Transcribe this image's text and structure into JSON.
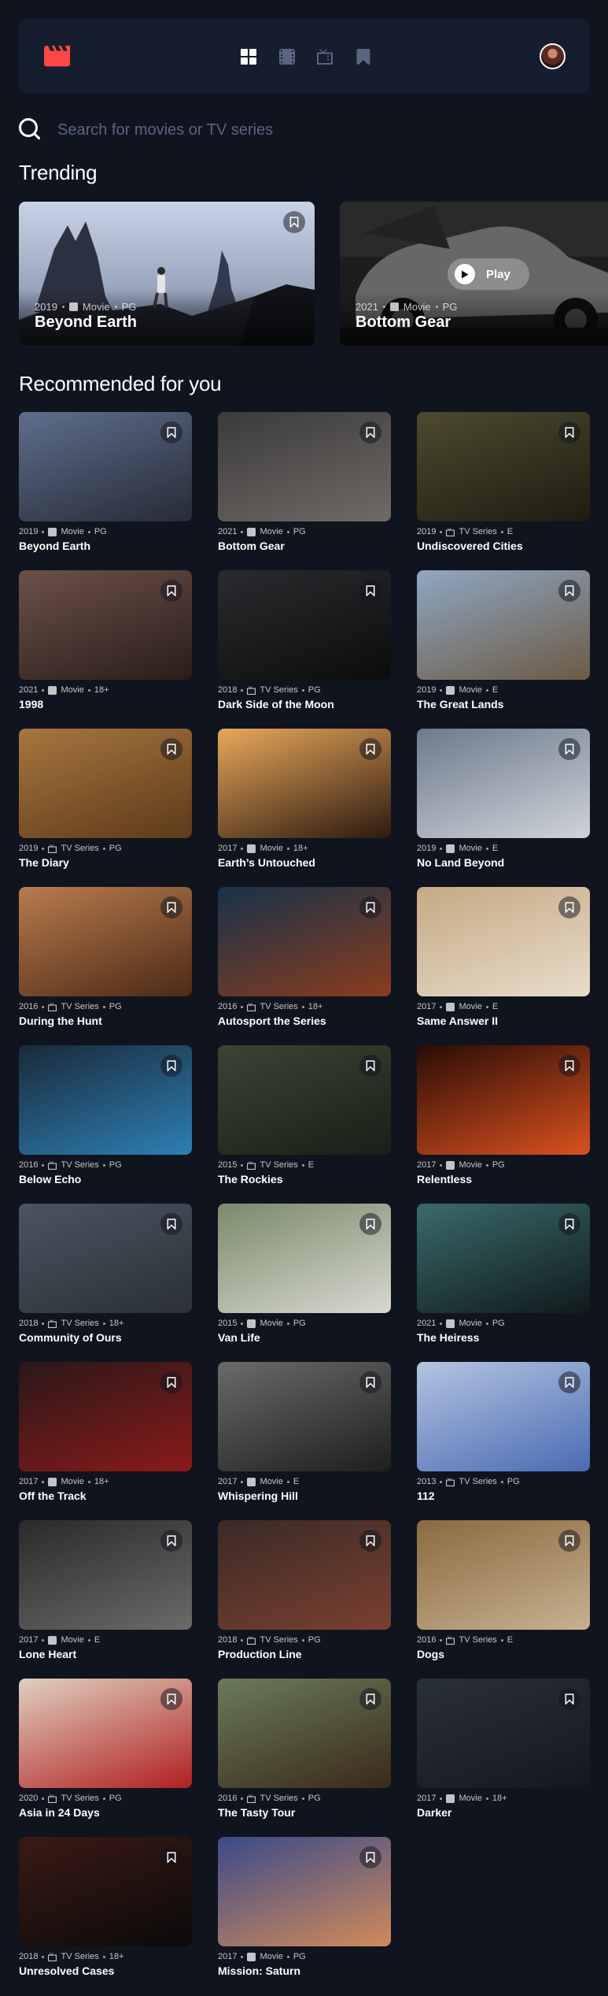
{
  "nav": {
    "logo_icon": "film-clapper-icon",
    "brand_color": "#fc4747",
    "items": [
      {
        "name": "nav-home",
        "icon": "grid-icon",
        "active": true
      },
      {
        "name": "nav-movies",
        "icon": "film-icon",
        "active": false
      },
      {
        "name": "nav-tv-series",
        "icon": "tv-icon",
        "active": false
      },
      {
        "name": "nav-bookmarks",
        "icon": "bookmark-icon",
        "active": false
      }
    ],
    "avatar": "user-avatar"
  },
  "search": {
    "placeholder": "Search for movies or TV series"
  },
  "trending": {
    "heading": "Trending",
    "items": [
      {
        "year": "2019",
        "category": "Movie",
        "rating": "PG",
        "title": "Beyond Earth",
        "bookmarked": false
      },
      {
        "year": "2021",
        "category": "Movie",
        "rating": "PG",
        "title": "Bottom Gear",
        "bookmarked": false,
        "play_label": "Play"
      }
    ]
  },
  "recommended": {
    "heading": "Recommended for you",
    "items": [
      {
        "year": "2019",
        "category": "Movie",
        "rating": "PG",
        "title": "Beyond Earth"
      },
      {
        "year": "2021",
        "category": "Movie",
        "rating": "PG",
        "title": "Bottom Gear"
      },
      {
        "year": "2019",
        "category": "TV Series",
        "rating": "E",
        "title": "Undiscovered Cities"
      },
      {
        "year": "2021",
        "category": "Movie",
        "rating": "18+",
        "title": "1998"
      },
      {
        "year": "2018",
        "category": "TV Series",
        "rating": "PG",
        "title": "Dark Side of the Moon"
      },
      {
        "year": "2019",
        "category": "Movie",
        "rating": "E",
        "title": "The Great Lands"
      },
      {
        "year": "2019",
        "category": "TV Series",
        "rating": "PG",
        "title": "The Diary"
      },
      {
        "year": "2017",
        "category": "Movie",
        "rating": "18+",
        "title": "Earth’s Untouched"
      },
      {
        "year": "2019",
        "category": "Movie",
        "rating": "E",
        "title": "No Land Beyond"
      },
      {
        "year": "2016",
        "category": "TV Series",
        "rating": "PG",
        "title": "During the Hunt"
      },
      {
        "year": "2016",
        "category": "TV Series",
        "rating": "18+",
        "title": "Autosport the Series"
      },
      {
        "year": "2017",
        "category": "Movie",
        "rating": "E",
        "title": "Same Answer II"
      },
      {
        "year": "2016",
        "category": "TV Series",
        "rating": "PG",
        "title": "Below Echo"
      },
      {
        "year": "2015",
        "category": "TV Series",
        "rating": "E",
        "title": "The Rockies"
      },
      {
        "year": "2017",
        "category": "Movie",
        "rating": "PG",
        "title": "Relentless"
      },
      {
        "year": "2018",
        "category": "TV Series",
        "rating": "18+",
        "title": "Community of Ours"
      },
      {
        "year": "2015",
        "category": "Movie",
        "rating": "PG",
        "title": "Van Life"
      },
      {
        "year": "2021",
        "category": "Movie",
        "rating": "PG",
        "title": "The Heiress"
      },
      {
        "year": "2017",
        "category": "Movie",
        "rating": "18+",
        "title": "Off the Track"
      },
      {
        "year": "2017",
        "category": "Movie",
        "rating": "E",
        "title": "Whispering Hill"
      },
      {
        "year": "2013",
        "category": "TV Series",
        "rating": "PG",
        "title": "112"
      },
      {
        "year": "2017",
        "category": "Movie",
        "rating": "E",
        "title": "Lone Heart"
      },
      {
        "year": "2018",
        "category": "TV Series",
        "rating": "PG",
        "title": "Production Line"
      },
      {
        "year": "2016",
        "category": "TV Series",
        "rating": "E",
        "title": "Dogs"
      },
      {
        "year": "2020",
        "category": "TV Series",
        "rating": "PG",
        "title": "Asia in 24 Days"
      },
      {
        "year": "2016",
        "category": "TV Series",
        "rating": "PG",
        "title": "The Tasty Tour"
      },
      {
        "year": "2017",
        "category": "Movie",
        "rating": "18+",
        "title": "Darker"
      },
      {
        "year": "2018",
        "category": "TV Series",
        "rating": "18+",
        "title": "Unresolved Cases"
      },
      {
        "year": "2017",
        "category": "Movie",
        "rating": "PG",
        "title": "Mission: Saturn"
      }
    ]
  },
  "colors": {
    "background": "#10141e",
    "surface": "#161d2f",
    "accent": "#fc4747",
    "muted": "#5a6580"
  }
}
